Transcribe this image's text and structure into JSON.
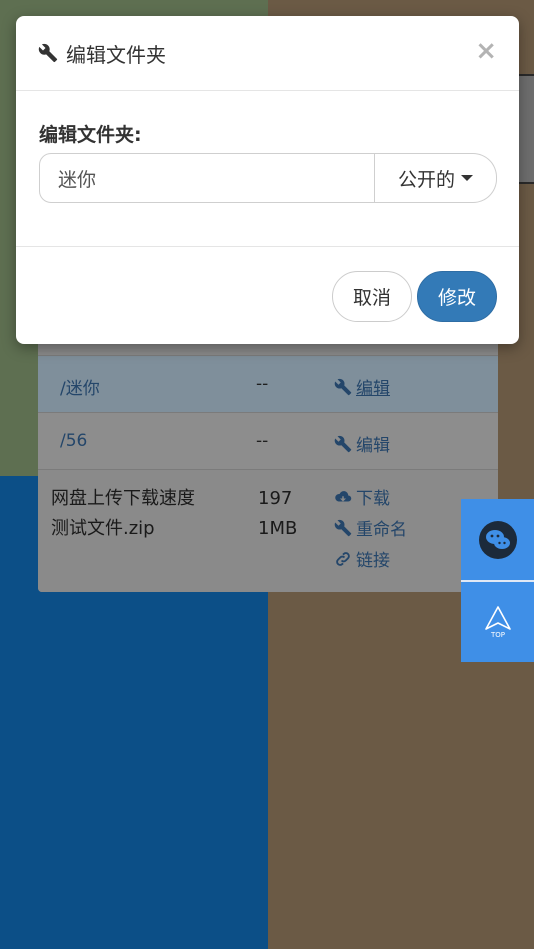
{
  "modal": {
    "title": "编辑文件夹",
    "close_symbol": "×",
    "field_label": "编辑文件夹:",
    "folder_name_value": "迷你",
    "visibility_selected": "公开的",
    "cancel_label": "取消",
    "submit_label": "修改",
    "title_icon": "wrench-icon"
  },
  "file_list": {
    "rows": [
      {
        "name": "/迷你",
        "size": "--",
        "action": "编辑",
        "action_icon": "wrench-icon"
      },
      {
        "name": "/56",
        "size": "--",
        "action": "编辑",
        "action_icon": "wrench-icon"
      }
    ],
    "file": {
      "name_line1": "网盘上传下载速度",
      "name_line2": "测试文件.zip",
      "size_line1": "197",
      "size_line2": "1MB",
      "actions": [
        {
          "label": "下载",
          "icon": "cloud-download-icon"
        },
        {
          "label": "重命名",
          "icon": "wrench-icon"
        },
        {
          "label": "链接",
          "icon": "link-icon"
        }
      ]
    }
  },
  "float_widgets": {
    "wechat_icon": "wechat-icon",
    "top_label": "TOP"
  },
  "colors": {
    "primary": "#337ab7",
    "float_blue": "#3f8fe7"
  }
}
